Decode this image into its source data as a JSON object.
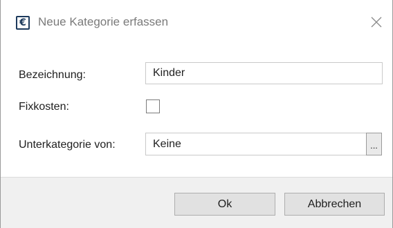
{
  "window": {
    "title": "Neue Kategorie erfassen",
    "icon": "euro-icon",
    "icon_glyph": "€",
    "close_icon": "close-icon"
  },
  "form": {
    "name_label": "Bezeichnung:",
    "name_value": "Kinder",
    "fixed_costs_label": "Fixkosten:",
    "fixed_costs_checked": false,
    "parent_label": "Unterkategorie von:",
    "parent_value": "Keine",
    "browse_label": "..."
  },
  "buttons": {
    "ok_label": "Ok",
    "cancel_label": "Abbrechen"
  },
  "colors": {
    "icon_accent": "#1d3a5c",
    "dialog_background": "#f0f0f0",
    "button_background": "#e1e1e1"
  }
}
